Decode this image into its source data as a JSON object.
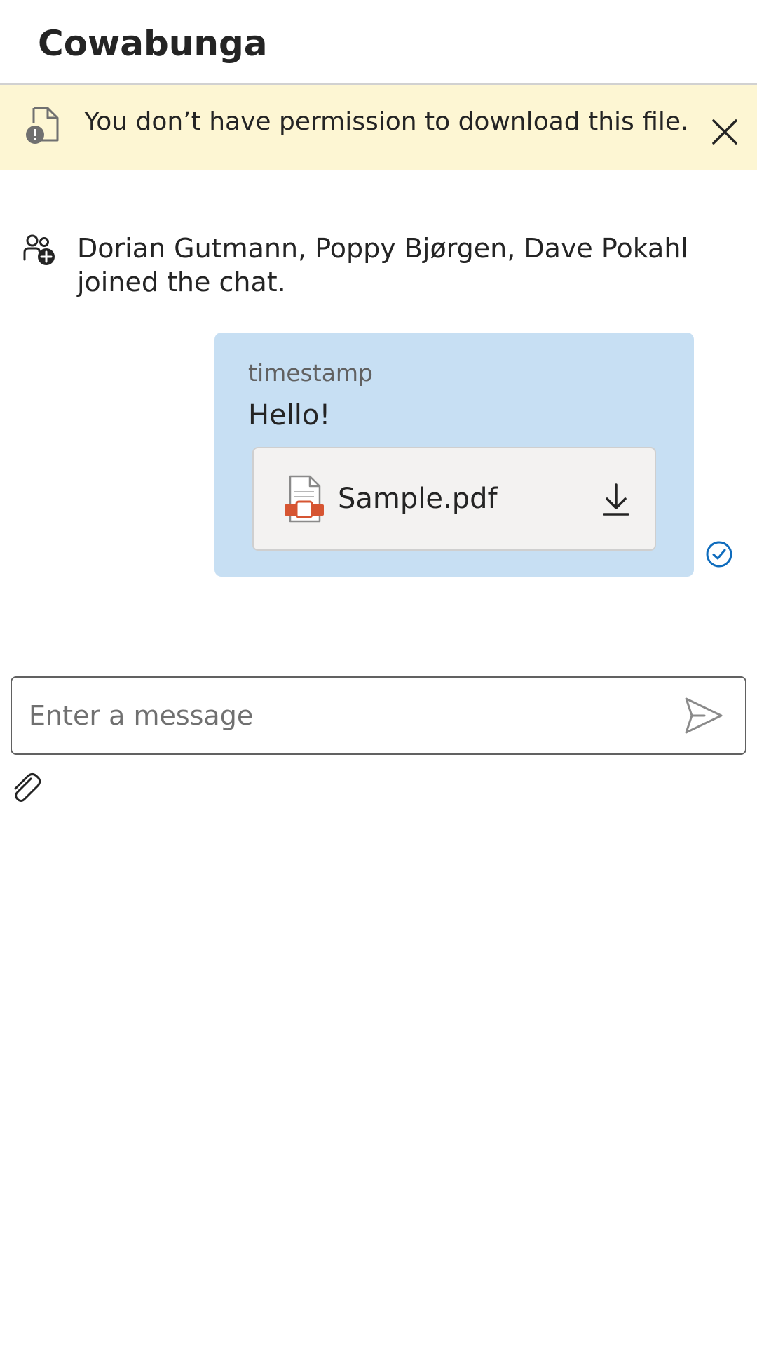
{
  "header": {
    "title": "Cowabunga"
  },
  "banner": {
    "icon": "document-warning-icon",
    "message": "You don’t have permission to download this file.",
    "close_icon": "close-icon",
    "background_color": "#fdf6d3"
  },
  "system_message": {
    "icon": "people-add-icon",
    "text": "Dorian Gutmann, Poppy Bjørgen, Dave Pokahl joined the chat."
  },
  "message": {
    "timestamp": "timestamp",
    "text": "Hello!",
    "bubble_color": "#c7dff3",
    "attachment": {
      "icon": "pdf-file-icon",
      "file_name": "Sample.pdf",
      "download_icon": "download-icon"
    },
    "status_icon": "read-receipt-check-icon",
    "status_color": "#0f6cbd"
  },
  "composer": {
    "placeholder": "Enter a message",
    "value": "",
    "send_icon": "send-icon",
    "attach_icon": "paperclip-icon"
  }
}
